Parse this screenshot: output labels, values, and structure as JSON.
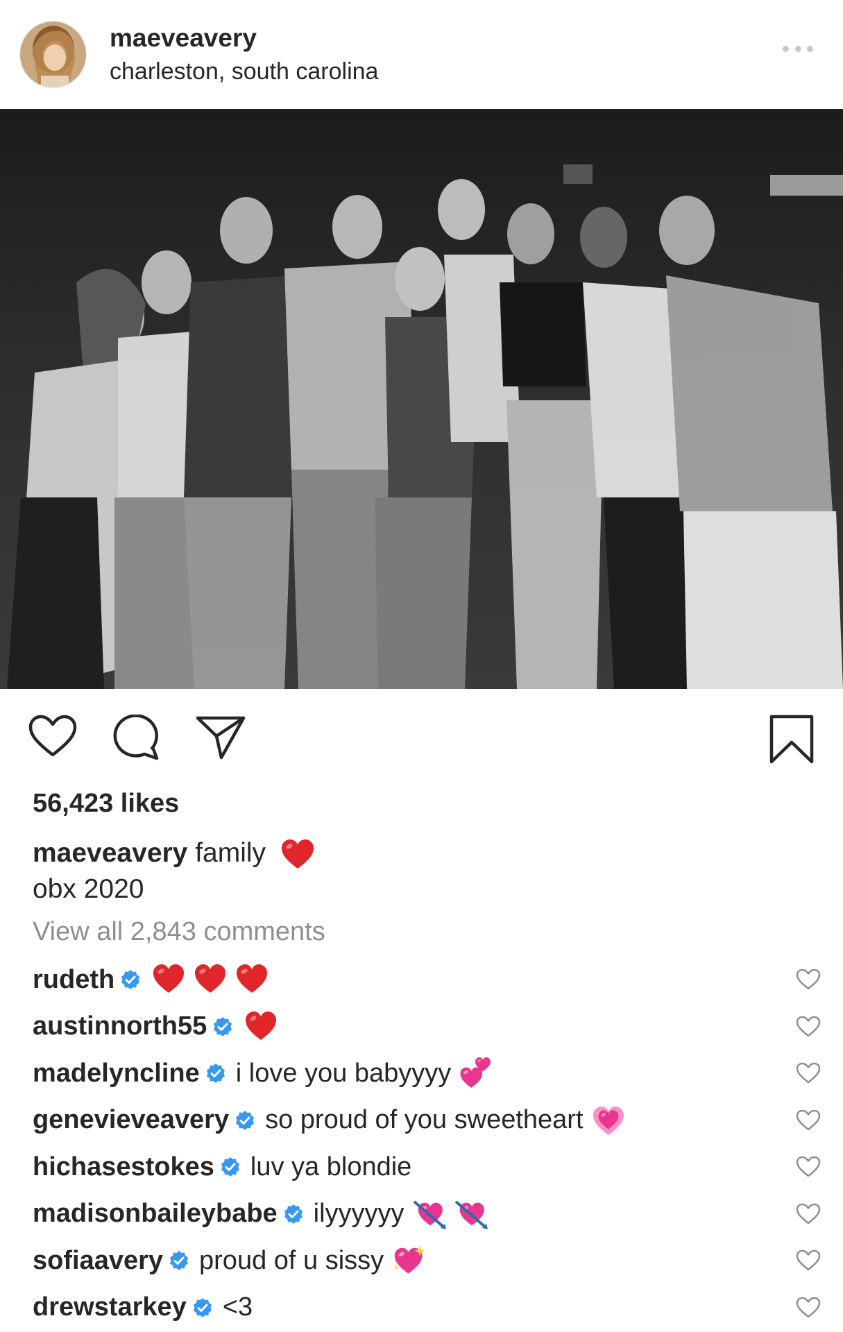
{
  "post": {
    "username": "maeveavery",
    "location": "charleston, south carolina",
    "more_icon": "more-horizontal-icon"
  },
  "actions": {
    "like_icon": "heart-outline-icon",
    "comment_icon": "comment-bubble-icon",
    "share_icon": "paper-plane-icon",
    "save_icon": "bookmark-icon"
  },
  "likes": "56,423 likes",
  "caption": {
    "username": "maeveavery",
    "line1": "family",
    "line1_emoji": "red-heart",
    "line2": "obx 2020"
  },
  "view_all_comments": "View all 2,843 comments",
  "comments": [
    {
      "username": "rudeth",
      "verified": true,
      "text": "",
      "emojis": [
        "red-heart",
        "red-heart",
        "red-heart"
      ]
    },
    {
      "username": "austinnorth55",
      "verified": true,
      "text": "",
      "emojis": [
        "red-heart"
      ]
    },
    {
      "username": "madelyncline",
      "verified": true,
      "text": "i love you babyyyy",
      "emojis": [
        "two-hearts"
      ]
    },
    {
      "username": "genevieveavery",
      "verified": true,
      "text": "so proud of you sweetheart",
      "emojis": [
        "growing-heart"
      ]
    },
    {
      "username": "hichasestokes",
      "verified": true,
      "text": "luv ya blondie",
      "emojis": []
    },
    {
      "username": "madisonbaileybabe",
      "verified": true,
      "text": "ilyyyyyy",
      "emojis": [
        "heart-with-arrow",
        "heart-with-arrow"
      ]
    },
    {
      "username": "sofiaavery",
      "verified": true,
      "text": "proud of u sissy",
      "emojis": [
        "sparkling-heart"
      ]
    },
    {
      "username": "drewstarkey",
      "verified": true,
      "text": "<3",
      "emojis": []
    }
  ],
  "colors": {
    "text": "#262626",
    "muted": "#8e8e8e",
    "verified": "#3897f0",
    "heart_red": "#e0262a"
  }
}
